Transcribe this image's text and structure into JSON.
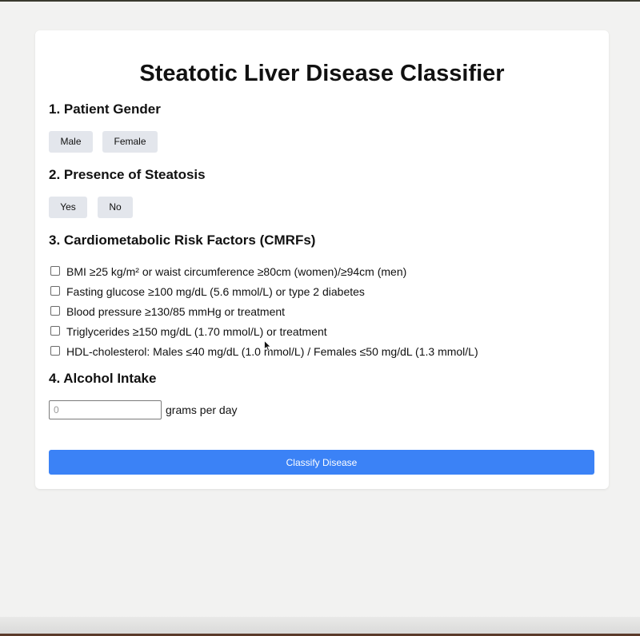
{
  "title": "Steatotic Liver Disease Classifier",
  "sections": {
    "gender": {
      "heading": "1. Patient Gender",
      "options": [
        "Male",
        "Female"
      ]
    },
    "steatosis": {
      "heading": "2. Presence of Steatosis",
      "options": [
        "Yes",
        "No"
      ]
    },
    "cmrf": {
      "heading": "3. Cardiometabolic Risk Factors (CMRFs)",
      "items": [
        {
          "label": "BMI ≥25 kg/m² or waist circumference ≥80cm (women)/≥94cm (men)",
          "checked": false
        },
        {
          "label": "Fasting glucose ≥100 mg/dL (5.6 mmol/L) or type 2 diabetes",
          "checked": false
        },
        {
          "label": "Blood pressure ≥130/85 mmHg or treatment",
          "checked": false
        },
        {
          "label": "Triglycerides ≥150 mg/dL (1.70 mmol/L) or treatment",
          "checked": false
        },
        {
          "label": "HDL-cholesterol: Males ≤40 mg/dL (1.0 mmol/L) / Females ≤50 mg/dL (1.3 mmol/L)",
          "checked": false
        }
      ]
    },
    "alcohol": {
      "heading": "4. Alcohol Intake",
      "placeholder": "0",
      "value": "",
      "unit": "grams per day"
    }
  },
  "submit_label": "Classify Disease",
  "colors": {
    "primary": "#3b82f6",
    "option_button_bg": "#e3e6ec",
    "page_bg": "#f2f2f1",
    "card_bg": "#ffffff"
  },
  "icons": {
    "cursor": "mouse-pointer-icon"
  }
}
